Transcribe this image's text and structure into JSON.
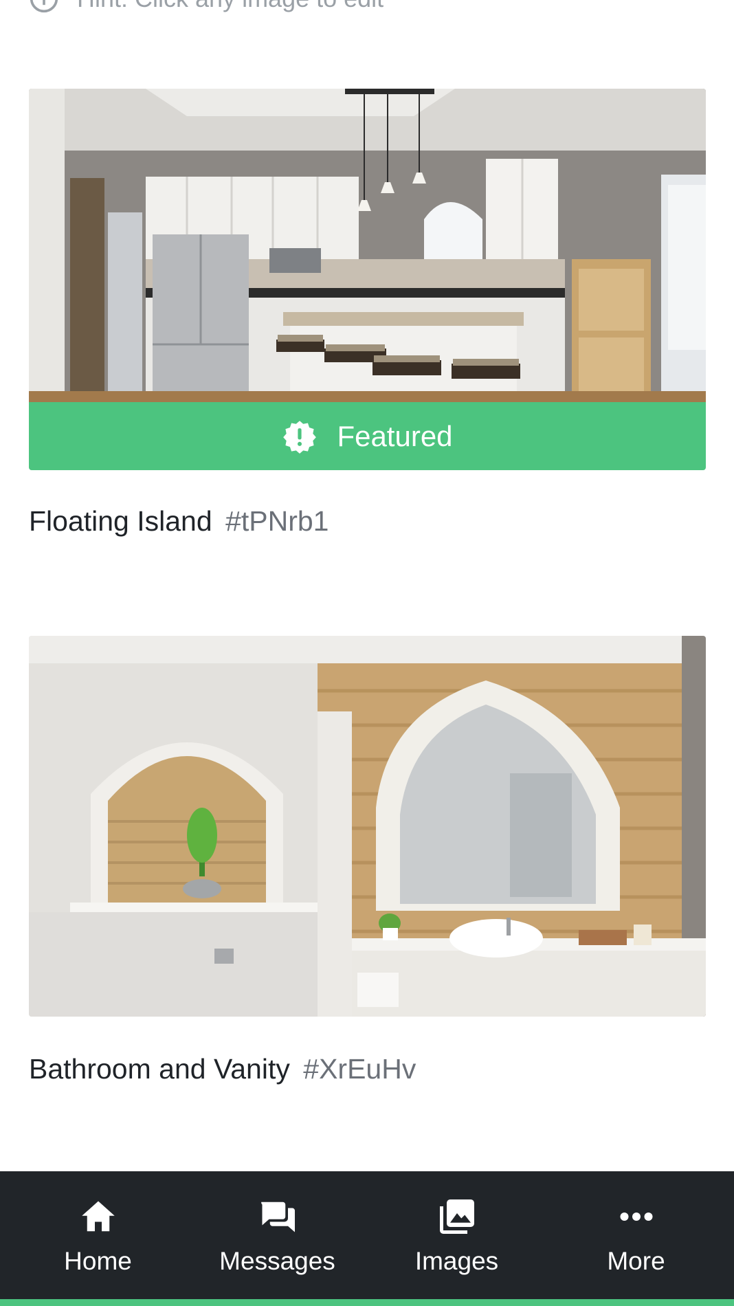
{
  "hint": {
    "text": "Hint: Click any image to edit",
    "icon": "info-icon"
  },
  "cards": [
    {
      "title": "Floating Island",
      "code": "#tPNrb1",
      "image_alt": "kitchen-photo",
      "featured": true,
      "featured_label": "Featured",
      "featured_icon": "badge-exclamation-icon"
    },
    {
      "title": "Bathroom and Vanity",
      "code": "#XrEuHv",
      "image_alt": "bathroom-photo",
      "featured": false
    }
  ],
  "bottom_nav": {
    "items": [
      {
        "label": "Home",
        "icon": "home-icon"
      },
      {
        "label": "Messages",
        "icon": "messages-icon"
      },
      {
        "label": "Images",
        "icon": "images-icon"
      },
      {
        "label": "More",
        "icon": "more-icon"
      }
    ]
  },
  "colors": {
    "accent": "#4cc47f",
    "nav_background": "#212529",
    "muted_text": "#6b7078",
    "hint_text": "#9aa0a6"
  }
}
